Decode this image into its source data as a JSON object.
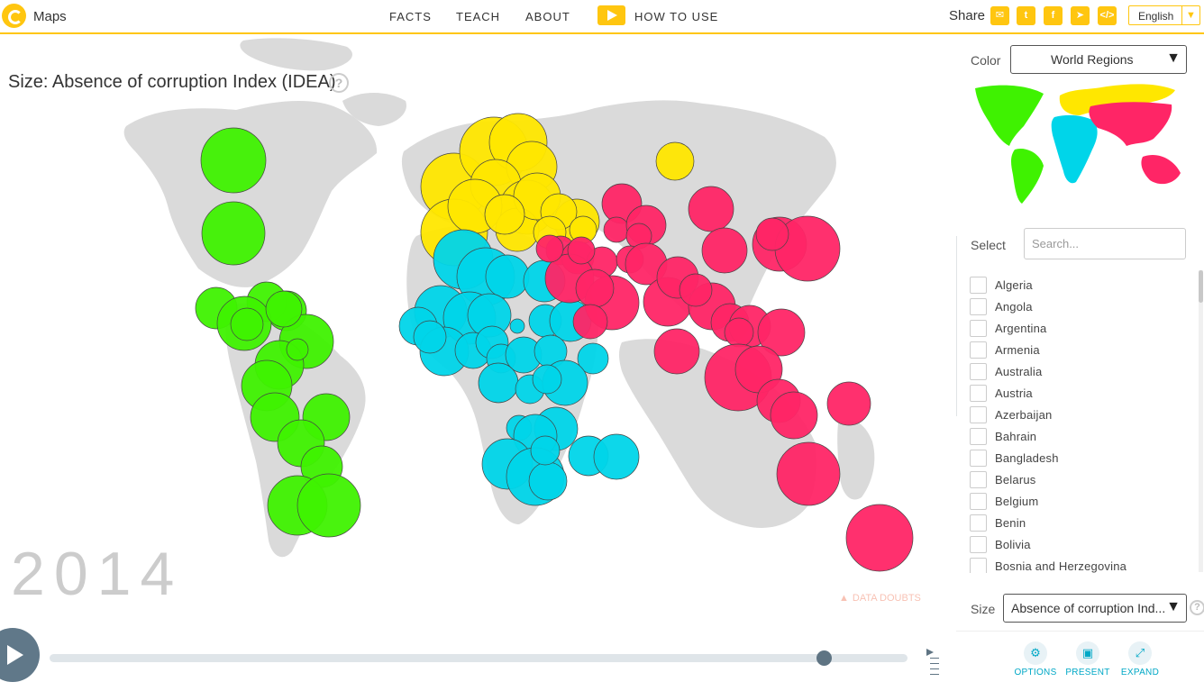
{
  "header": {
    "app_title": "Maps",
    "nav": [
      "FACTS",
      "TEACH",
      "ABOUT",
      "HOW TO USE"
    ],
    "share_label": "Share",
    "share_icons": [
      "mail-icon",
      "twitter-icon",
      "facebook-icon",
      "telegram-icon",
      "embed-code-icon"
    ],
    "language": "English",
    "accent_color": "#ffc610"
  },
  "chart": {
    "size_title": "Size: Absence of corruption Index (IDEA)",
    "year": "2014",
    "data_doubts": "DATA DOUBTS",
    "region_colors": {
      "americas": "#3ff201",
      "europe": "#ffe700",
      "africa": "#00d5e9",
      "asia": "#ff2566"
    }
  },
  "timeline": {
    "year": 2014,
    "progress": 0.9
  },
  "side": {
    "color_label": "Color",
    "color_value": "World Regions",
    "select_label": "Select",
    "search_placeholder": "Search...",
    "countries": [
      "Algeria",
      "Angola",
      "Argentina",
      "Armenia",
      "Australia",
      "Austria",
      "Azerbaijan",
      "Bahrain",
      "Bangladesh",
      "Belarus",
      "Belgium",
      "Benin",
      "Bolivia",
      "Bosnia and Herzegovina"
    ],
    "size_label": "Size",
    "size_value": "Absence of corruption Ind...",
    "tools": [
      {
        "label": "OPTIONS",
        "icon": "gear-icon"
      },
      {
        "label": "PRESENT",
        "icon": "presentation-icon"
      },
      {
        "label": "EXPAND",
        "icon": "expand-icon"
      }
    ]
  }
}
